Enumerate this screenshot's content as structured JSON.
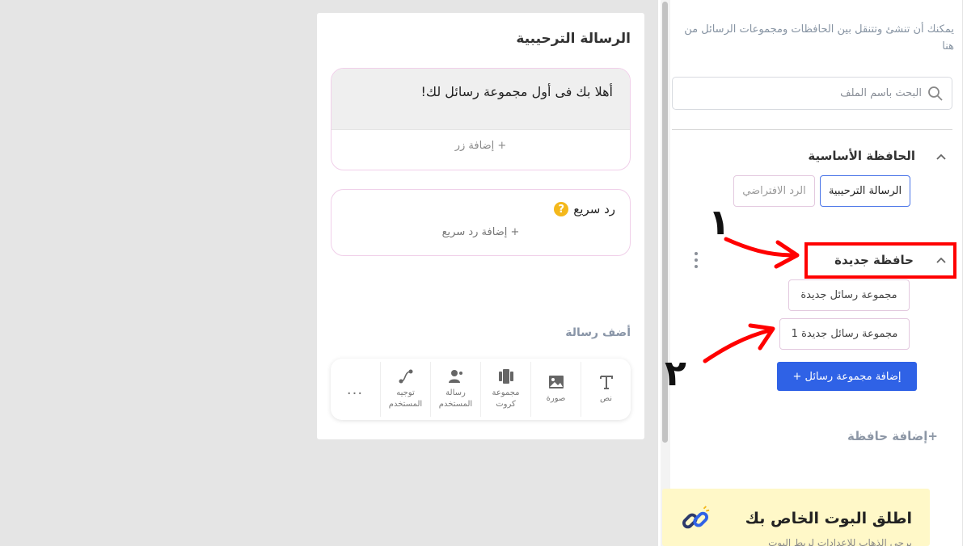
{
  "sidebar": {
    "hint": "يمكنك أن تنشئ وتتنقل بين الحافظات ومجموعات الرسائل من هنا",
    "search_placeholder": "البحث باسم الملف",
    "folders": [
      {
        "title": "الحافظة الأساسية",
        "items": [
          "الرسالة الترحيبية",
          "الرد الافتراضي"
        ]
      },
      {
        "title": "حافظة جديدة",
        "items": [
          "مجموعة رسائل جديدة",
          "مجموعة رسائل جديدة 1"
        ]
      }
    ],
    "add_group_label": "إضافة مجموعة رسائل +",
    "add_folder_label": "+إضافة حافظة",
    "launch": {
      "title": "اطلق البوت الخاص بك",
      "subtitle": "برجى الذهاب للإعدادات لربط البوت"
    }
  },
  "card": {
    "title": "الرسالة الترحيبية",
    "message_text": "أهلا بك فى أول مجموعة رسائل لك!",
    "add_button": "+ إضافة زر",
    "quick_reply_title": "رد سريع",
    "add_quick_reply": "+ إضافة رد سريع",
    "add_message_label": "أضف رسالة",
    "tools": [
      {
        "label": "نص",
        "icon": "text-icon"
      },
      {
        "label": "صورة",
        "icon": "image-icon"
      },
      {
        "label": "مجموعة كروت",
        "icon": "cards-icon"
      },
      {
        "label": "رسالة المستخدم",
        "icon": "user-message-icon"
      },
      {
        "label": "توجيه المستخدم",
        "icon": "route-icon"
      }
    ],
    "more": "..."
  },
  "annotations": {
    "one": "١",
    "two": "٢",
    "color": "#ff0000"
  },
  "colors": {
    "primary": "#2f62e6",
    "active_border": "#4a74e8",
    "chip_border": "#e3c9df",
    "launch_bg": "#fff8c8"
  }
}
